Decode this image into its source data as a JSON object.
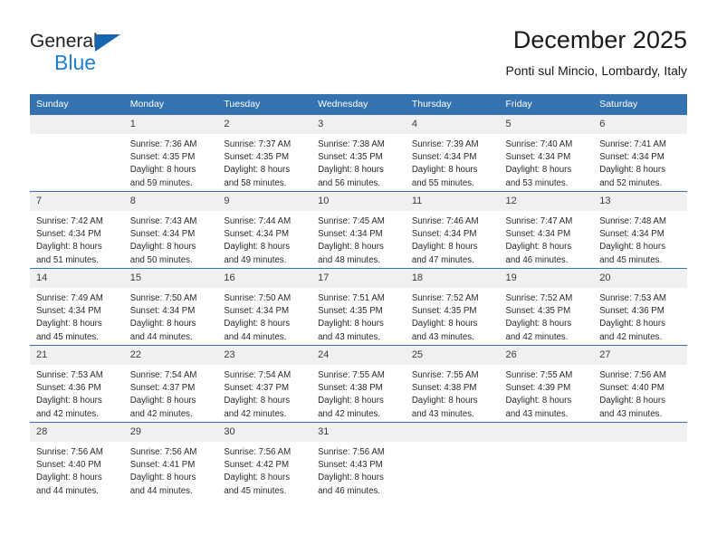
{
  "logo": {
    "primary_text": "General",
    "secondary_text": "Blue",
    "triangle_color": "#1565b0",
    "secondary_color": "#1f7fd0"
  },
  "header": {
    "title": "December 2025",
    "subtitle": "Ponti sul Mincio, Lombardy, Italy"
  },
  "colors": {
    "header_blue": "#3572b0",
    "daynum_band": "#f0f0f0"
  },
  "weekdays": [
    "Sunday",
    "Monday",
    "Tuesday",
    "Wednesday",
    "Thursday",
    "Friday",
    "Saturday"
  ],
  "weeks": [
    [
      {
        "day": "",
        "lines": []
      },
      {
        "day": "1",
        "lines": [
          "Sunrise: 7:36 AM",
          "Sunset: 4:35 PM",
          "Daylight: 8 hours",
          "and 59 minutes."
        ]
      },
      {
        "day": "2",
        "lines": [
          "Sunrise: 7:37 AM",
          "Sunset: 4:35 PM",
          "Daylight: 8 hours",
          "and 58 minutes."
        ]
      },
      {
        "day": "3",
        "lines": [
          "Sunrise: 7:38 AM",
          "Sunset: 4:35 PM",
          "Daylight: 8 hours",
          "and 56 minutes."
        ]
      },
      {
        "day": "4",
        "lines": [
          "Sunrise: 7:39 AM",
          "Sunset: 4:34 PM",
          "Daylight: 8 hours",
          "and 55 minutes."
        ]
      },
      {
        "day": "5",
        "lines": [
          "Sunrise: 7:40 AM",
          "Sunset: 4:34 PM",
          "Daylight: 8 hours",
          "and 53 minutes."
        ]
      },
      {
        "day": "6",
        "lines": [
          "Sunrise: 7:41 AM",
          "Sunset: 4:34 PM",
          "Daylight: 8 hours",
          "and 52 minutes."
        ]
      }
    ],
    [
      {
        "day": "7",
        "lines": [
          "Sunrise: 7:42 AM",
          "Sunset: 4:34 PM",
          "Daylight: 8 hours",
          "and 51 minutes."
        ]
      },
      {
        "day": "8",
        "lines": [
          "Sunrise: 7:43 AM",
          "Sunset: 4:34 PM",
          "Daylight: 8 hours",
          "and 50 minutes."
        ]
      },
      {
        "day": "9",
        "lines": [
          "Sunrise: 7:44 AM",
          "Sunset: 4:34 PM",
          "Daylight: 8 hours",
          "and 49 minutes."
        ]
      },
      {
        "day": "10",
        "lines": [
          "Sunrise: 7:45 AM",
          "Sunset: 4:34 PM",
          "Daylight: 8 hours",
          "and 48 minutes."
        ]
      },
      {
        "day": "11",
        "lines": [
          "Sunrise: 7:46 AM",
          "Sunset: 4:34 PM",
          "Daylight: 8 hours",
          "and 47 minutes."
        ]
      },
      {
        "day": "12",
        "lines": [
          "Sunrise: 7:47 AM",
          "Sunset: 4:34 PM",
          "Daylight: 8 hours",
          "and 46 minutes."
        ]
      },
      {
        "day": "13",
        "lines": [
          "Sunrise: 7:48 AM",
          "Sunset: 4:34 PM",
          "Daylight: 8 hours",
          "and 45 minutes."
        ]
      }
    ],
    [
      {
        "day": "14",
        "lines": [
          "Sunrise: 7:49 AM",
          "Sunset: 4:34 PM",
          "Daylight: 8 hours",
          "and 45 minutes."
        ]
      },
      {
        "day": "15",
        "lines": [
          "Sunrise: 7:50 AM",
          "Sunset: 4:34 PM",
          "Daylight: 8 hours",
          "and 44 minutes."
        ]
      },
      {
        "day": "16",
        "lines": [
          "Sunrise: 7:50 AM",
          "Sunset: 4:34 PM",
          "Daylight: 8 hours",
          "and 44 minutes."
        ]
      },
      {
        "day": "17",
        "lines": [
          "Sunrise: 7:51 AM",
          "Sunset: 4:35 PM",
          "Daylight: 8 hours",
          "and 43 minutes."
        ]
      },
      {
        "day": "18",
        "lines": [
          "Sunrise: 7:52 AM",
          "Sunset: 4:35 PM",
          "Daylight: 8 hours",
          "and 43 minutes."
        ]
      },
      {
        "day": "19",
        "lines": [
          "Sunrise: 7:52 AM",
          "Sunset: 4:35 PM",
          "Daylight: 8 hours",
          "and 42 minutes."
        ]
      },
      {
        "day": "20",
        "lines": [
          "Sunrise: 7:53 AM",
          "Sunset: 4:36 PM",
          "Daylight: 8 hours",
          "and 42 minutes."
        ]
      }
    ],
    [
      {
        "day": "21",
        "lines": [
          "Sunrise: 7:53 AM",
          "Sunset: 4:36 PM",
          "Daylight: 8 hours",
          "and 42 minutes."
        ]
      },
      {
        "day": "22",
        "lines": [
          "Sunrise: 7:54 AM",
          "Sunset: 4:37 PM",
          "Daylight: 8 hours",
          "and 42 minutes."
        ]
      },
      {
        "day": "23",
        "lines": [
          "Sunrise: 7:54 AM",
          "Sunset: 4:37 PM",
          "Daylight: 8 hours",
          "and 42 minutes."
        ]
      },
      {
        "day": "24",
        "lines": [
          "Sunrise: 7:55 AM",
          "Sunset: 4:38 PM",
          "Daylight: 8 hours",
          "and 42 minutes."
        ]
      },
      {
        "day": "25",
        "lines": [
          "Sunrise: 7:55 AM",
          "Sunset: 4:38 PM",
          "Daylight: 8 hours",
          "and 43 minutes."
        ]
      },
      {
        "day": "26",
        "lines": [
          "Sunrise: 7:55 AM",
          "Sunset: 4:39 PM",
          "Daylight: 8 hours",
          "and 43 minutes."
        ]
      },
      {
        "day": "27",
        "lines": [
          "Sunrise: 7:56 AM",
          "Sunset: 4:40 PM",
          "Daylight: 8 hours",
          "and 43 minutes."
        ]
      }
    ],
    [
      {
        "day": "28",
        "lines": [
          "Sunrise: 7:56 AM",
          "Sunset: 4:40 PM",
          "Daylight: 8 hours",
          "and 44 minutes."
        ]
      },
      {
        "day": "29",
        "lines": [
          "Sunrise: 7:56 AM",
          "Sunset: 4:41 PM",
          "Daylight: 8 hours",
          "and 44 minutes."
        ]
      },
      {
        "day": "30",
        "lines": [
          "Sunrise: 7:56 AM",
          "Sunset: 4:42 PM",
          "Daylight: 8 hours",
          "and 45 minutes."
        ]
      },
      {
        "day": "31",
        "lines": [
          "Sunrise: 7:56 AM",
          "Sunset: 4:43 PM",
          "Daylight: 8 hours",
          "and 46 minutes."
        ]
      },
      {
        "day": "",
        "lines": []
      },
      {
        "day": "",
        "lines": []
      },
      {
        "day": "",
        "lines": []
      }
    ]
  ]
}
